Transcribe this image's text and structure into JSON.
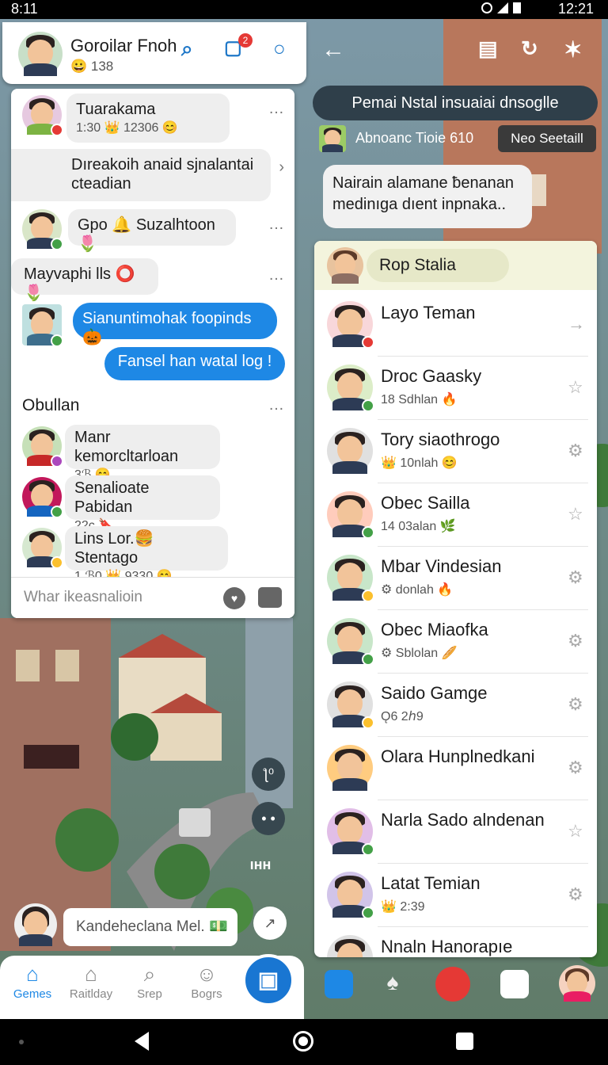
{
  "statusbar": {
    "time_left": "8:11",
    "time_right": "12:21"
  },
  "left": {
    "header": {
      "name": "Goroilar Fnoh",
      "sub": "😀 138",
      "icons": [
        "search-icon",
        "camera-icon",
        "pin-icon"
      ],
      "badge": "2"
    },
    "messages": [
      {
        "title": "Tuarakama",
        "sub": "1:30 👑 12306 😊",
        "badge_color": "#e53935"
      },
      {
        "title": "Dıreakoih anaid sjnalantai cteadian",
        "sub": "",
        "badge_color": "#e91e63"
      },
      {
        "title": "Gpo 🔔 Suzalhtoon 🌷",
        "sub": "",
        "badge_color": "#43a047"
      }
    ],
    "section1": "Mayvaphi lls",
    "section1_icons": "⭕🌷",
    "blue_bubbles": [
      "Sianuntimohak foopinds 🎃",
      "Fansel han watal log !"
    ],
    "section2": "Obullan",
    "group_messages": [
      {
        "title": "Manr kemorcltarloan",
        "sub": "3ℬ 😊",
        "badge_color": "#ab47bc"
      },
      {
        "title": "Senalioate Pabidan",
        "sub": "22c 🔖",
        "badge_color": "#43a047"
      },
      {
        "title": "Lins Lor.🍔 Stentago",
        "sub": "1.ℬ0 👑 9330 😊",
        "badge_color": "#fbc02d"
      }
    ],
    "input_placeholder": "Whar ikeasnalioin"
  },
  "right": {
    "notice": "Pemai Nstal insuaiai dnsoglle",
    "subbar_label": "Abnoanc Tioie 610",
    "subbar_tag": "Neo Seetaill",
    "bubble": "Nairain alamane ƀenanan medinıga dıent inpnaka..",
    "list_header": "Rop Stalia",
    "contacts": [
      {
        "name": "Layo Teman",
        "sub": "",
        "action": "→",
        "badge_color": "#e53935"
      },
      {
        "name": "Droc Gaasky",
        "sub": "18 Sdhlan 🔥",
        "action": "☆",
        "badge_color": "#43a047"
      },
      {
        "name": "Tory siaothrogo",
        "sub": "👑 10nlah 😊",
        "action": "⚙",
        "badge_color": ""
      },
      {
        "name": "Obec Sailla",
        "sub": "14 03alan 🌿",
        "action": "☆",
        "badge_color": "#43a047"
      },
      {
        "name": "Mbar Vindesian",
        "sub": "⚙ donlah 🔥",
        "action": "⚙",
        "badge_color": "#fbc02d"
      },
      {
        "name": "Obec Miaofka",
        "sub": "⚙ Sblolan 🥖",
        "action": "⚙",
        "badge_color": "#43a047"
      },
      {
        "name": "Saido Gamge",
        "sub": "Ǫ6 2ℎ9",
        "action": "⚙",
        "badge_color": "#fbc02d"
      },
      {
        "name": "Olara Hunplnedkani",
        "sub": "",
        "action": "⚙",
        "badge_color": ""
      },
      {
        "name": "Narla Sado alndenan",
        "sub": "",
        "action": "☆",
        "badge_color": "#43a047"
      },
      {
        "name": "Latat Temian",
        "sub": "👑 2:39",
        "action": "⚙",
        "badge_color": "#43a047"
      },
      {
        "name": "Nnaln Hanorapıe",
        "sub": "",
        "action": "",
        "badge_color": ""
      }
    ]
  },
  "bottom_left_tabs": [
    {
      "label": "Gemes",
      "icon": "home-icon"
    },
    {
      "label": "Raitlday",
      "icon": "house-icon"
    },
    {
      "label": "Srep",
      "icon": "search-icon"
    },
    {
      "label": "Bogrs",
      "icon": "profile-icon"
    }
  ],
  "toast": "Kandeheclana Mel. 💵",
  "floating": [
    "ƪ⁰",
    "• •",
    "ıнн"
  ],
  "colors": {
    "accent": "#1e88e5",
    "panel": "#ffffff",
    "notice": "#2f3f4a"
  }
}
